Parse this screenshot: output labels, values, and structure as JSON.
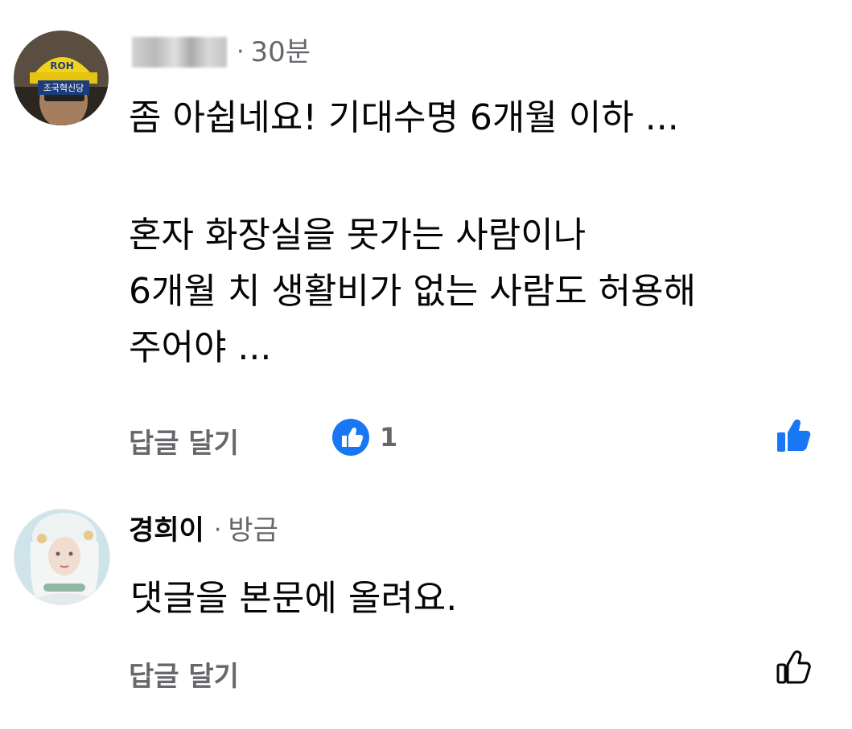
{
  "comments": [
    {
      "author": "",
      "author_redacted": true,
      "time": "30분",
      "separator": "·",
      "body": [
        "좀 아쉽네요! 기대수명 6개월 이하 ...",
        "",
        "혼자 화장실을 못가는 사람이나",
        "6개월 치 생활비가 없는 사람도 허용해",
        "주어야 ..."
      ],
      "reply_label": "답글 달기",
      "reaction_count": "1",
      "liked": true,
      "avatar_badge_text": "조국혁신당",
      "avatar_cap_text": "ROH"
    },
    {
      "author": "경희이",
      "time": "방금",
      "separator": "·",
      "body": [
        "댓글을 본문에 올려요."
      ],
      "reply_label": "답글 달기",
      "liked": false
    }
  ],
  "colors": {
    "like_blue": "#1877F2",
    "secondary_text": "#65676B",
    "primary_text": "#050505"
  },
  "icons": {
    "reaction": "like-reaction-icon",
    "like_active": "thumbs-up-filled-icon",
    "like_inactive": "thumbs-up-outline-icon"
  }
}
